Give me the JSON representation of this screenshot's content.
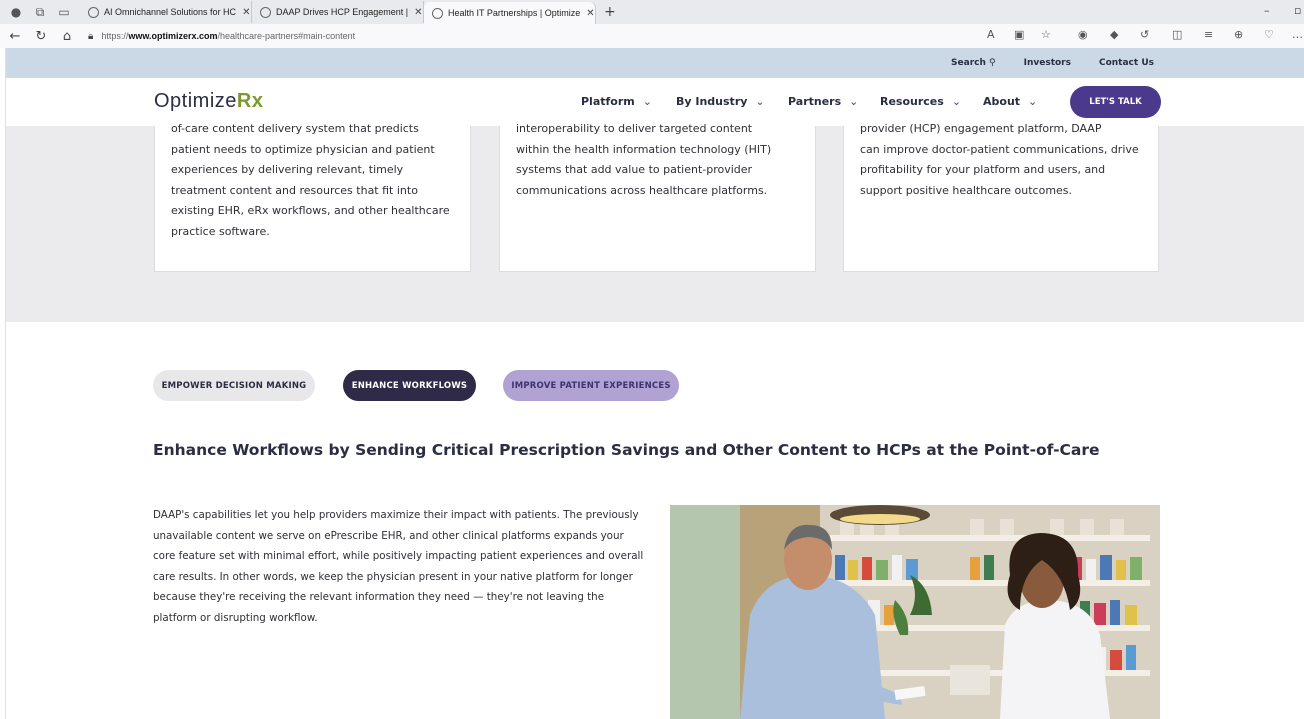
{
  "browser": {
    "tabs": [
      {
        "title": "AI Omnichannel Solutions for HC",
        "active": false
      },
      {
        "title": "DAAP Drives HCP Engagement |",
        "active": false
      },
      {
        "title": "Health IT Partnerships | Optimize",
        "active": true
      }
    ],
    "url_prefix": "https://",
    "url_domain": "www.optimizerx.com",
    "url_path": "/healthcare-partners#main-content"
  },
  "utility_nav": {
    "search": "Search",
    "investors": "Investors",
    "contact": "Contact Us"
  },
  "nav": {
    "logo_text": "Optimize",
    "logo_rx": "Rx",
    "items": [
      "Platform",
      "By Industry",
      "Partners",
      "Resources",
      "About"
    ],
    "cta": "LET'S TALK"
  },
  "cards": [
    {
      "partial_line": "of-care content delivery system that predicts",
      "text": "patient needs to optimize physician and patient experiences by delivering relevant, timely treatment content and resources that fit into existing EHR, eRx workflows, and other healthcare practice software."
    },
    {
      "partial_line": "interoperability to deliver targeted content",
      "text": "within the health information technology (HIT) systems that add value to patient-provider communications across healthcare platforms."
    },
    {
      "partial_line": "provider (HCP) engagement platform, DAAP",
      "text": "can improve doctor-patient communications, drive profitability for your platform and users, and support positive healthcare outcomes."
    }
  ],
  "tabs_section": {
    "pills": [
      "EMPOWER DECISION MAKING",
      "ENHANCE WORKFLOWS",
      "IMPROVE PATIENT EXPERIENCES"
    ],
    "active_pill": "ENHANCE WORKFLOWS",
    "headline": "Enhance Workflows by Sending Critical Prescription Savings and Other Content to HCPs at the Point-of-Care",
    "body": "DAAP's capabilities let you help providers maximize their impact with patients. The previously unavailable content we serve on ePrescribe EHR, and other clinical platforms expands your core feature set with minimal effort, while positively impacting patient experiences and overall care results. In other words, we keep the physician present in your native platform for longer because they're receiving the relevant information they need — they're not leaving the platform or disrupting workflow."
  },
  "colors": {
    "brand_purple": "#4b3a8c",
    "dark_pill": "#2e2a48",
    "light_purple_pill": "#b0a3d4",
    "rx_green": "#7a9a2c",
    "util_bar": "#cbd9e6"
  }
}
